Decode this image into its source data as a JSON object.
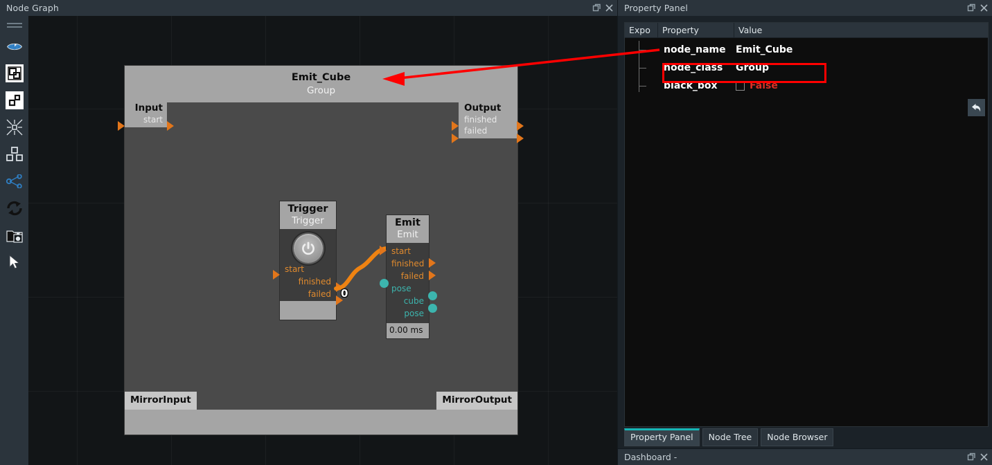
{
  "left_panel": {
    "title": "Node Graph",
    "window_buttons": [
      {
        "name": "float-icon",
        "label": ""
      },
      {
        "name": "close-icon",
        "label": ""
      }
    ],
    "toolbar": [
      {
        "name": "grip-handle",
        "label": "drag-handle"
      },
      {
        "name": "eye-icon",
        "label": "visibility"
      },
      {
        "name": "frame-all-icon",
        "label": "frame-all"
      },
      {
        "name": "frame-selected-icon",
        "label": "frame-selected"
      },
      {
        "name": "collapse-icon",
        "label": "collapse"
      },
      {
        "name": "layout-nodes-icon",
        "label": "layout-nodes"
      },
      {
        "name": "share-graph-icon",
        "label": "share-graph"
      },
      {
        "name": "refresh-icon",
        "label": "refresh"
      },
      {
        "name": "screenshot-icon",
        "label": "screenshot"
      },
      {
        "name": "cursor-icon",
        "label": "select-tool"
      }
    ]
  },
  "graph": {
    "group_node": {
      "name": "Emit_Cube",
      "class": "Group",
      "input_box": {
        "title": "Input",
        "ports": [
          "start"
        ]
      },
      "output_box": {
        "title": "Output",
        "ports": [
          "finished",
          "failed"
        ]
      },
      "mirror_input": "MirrorInput",
      "mirror_output": "MirrorOutput"
    },
    "trigger_node": {
      "name": "Trigger",
      "class": "Trigger",
      "inputs": [
        "start"
      ],
      "outputs": [
        "finished",
        "failed"
      ],
      "widget": "power-button"
    },
    "emit_node": {
      "name": "Emit",
      "class": "Emit",
      "exec_in": [
        "start"
      ],
      "exec_out": [
        "finished",
        "failed"
      ],
      "data_in": [
        "pose"
      ],
      "data_out": [
        "cube",
        "pose"
      ],
      "time": "0.00 ms"
    },
    "wire_label": "0"
  },
  "right_panel": {
    "title": "Property Panel",
    "columns": [
      "Expo",
      "Property",
      "Value"
    ],
    "rows": [
      {
        "property": "node_name",
        "value": "Emit_Cube",
        "type": "text",
        "highlighted": true
      },
      {
        "property": "node_class",
        "value": "Group",
        "type": "text",
        "highlighted": false
      },
      {
        "property": "black_box",
        "value": "False",
        "type": "checkbox",
        "checked": false,
        "highlighted": false
      }
    ],
    "undo_button": "undo-icon",
    "tabs": [
      {
        "label": "Property Panel",
        "active": true
      },
      {
        "label": "Node Tree",
        "active": false
      },
      {
        "label": "Node Browser",
        "active": false
      }
    ]
  },
  "dashboard": {
    "title": "Dashboard -"
  },
  "colors": {
    "accent_teal": "#16b5b5",
    "exec_orange": "#e2761b",
    "data_teal": "#3cb5ae",
    "annotation_red": "#ff0000",
    "false_red": "#d93025"
  }
}
